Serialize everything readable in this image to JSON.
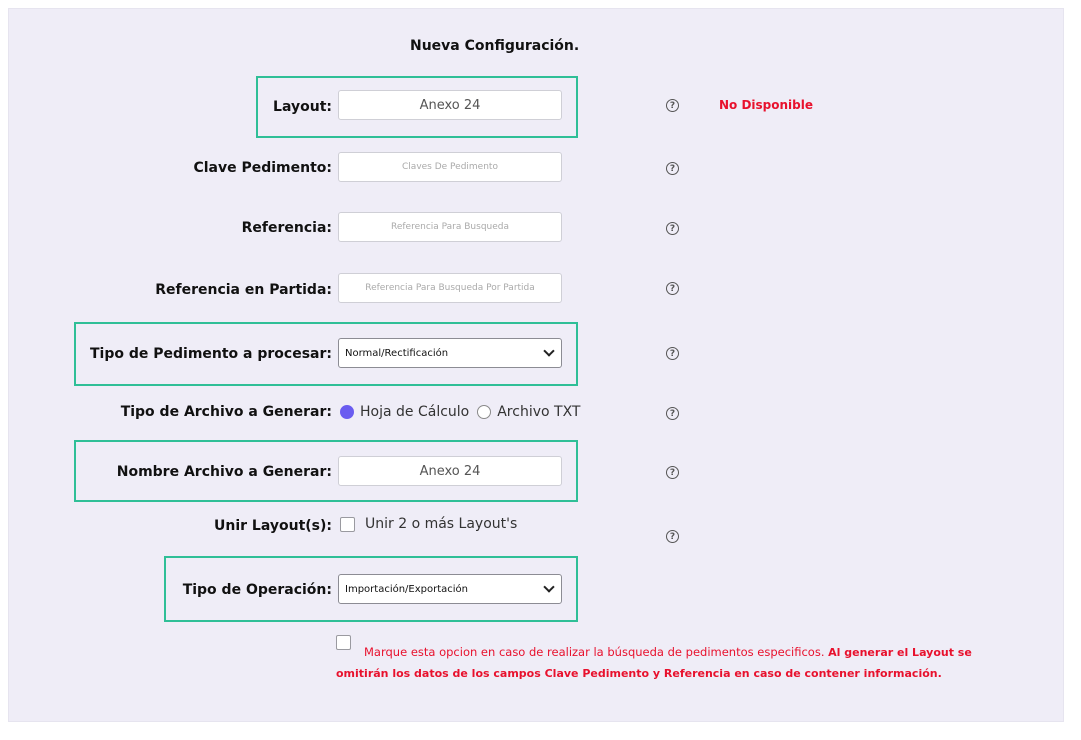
{
  "form": {
    "title": "Nueva Configuración.",
    "layout": {
      "label": "Layout:",
      "value": "Anexo 24",
      "status": "No Disponible"
    },
    "clave_pedimento": {
      "label": "Clave Pedimento:",
      "placeholder": "Claves De Pedimento"
    },
    "referencia": {
      "label": "Referencia:",
      "placeholder": "Referencia Para Busqueda"
    },
    "referencia_partida": {
      "label": "Referencia en Partida:",
      "placeholder": "Referencia Para Busqueda Por Partida"
    },
    "tipo_pedimento": {
      "label": "Tipo de Pedimento a procesar:",
      "selected": "Normal/Rectificación"
    },
    "tipo_archivo": {
      "label": "Tipo de Archivo a Generar:",
      "options": [
        {
          "label": "Hoja de Cálculo",
          "checked": true
        },
        {
          "label": "Archivo TXT",
          "checked": false
        }
      ]
    },
    "nombre_archivo": {
      "label": "Nombre Archivo a Generar:",
      "value": "Anexo 24"
    },
    "unir_layouts": {
      "label": "Unir Layout(s):",
      "checkbox_label": "Unir 2 o más Layout's",
      "checked": false
    },
    "tipo_operacion": {
      "label": "Tipo de Operación:",
      "selected": "Importación/Exportación"
    },
    "nota": {
      "normal": "Marque esta opcion en caso de realizar la búsqueda de pedimentos especificos. ",
      "bold": "Al generar el Layout se omitirán los datos de los campos Clave Pedimento y Referencia en caso de contener información.",
      "checked": false
    },
    "help_icon": "question-circle-icon"
  },
  "colors": {
    "panel_bg": "#efedf7",
    "highlight": "#2fbf97",
    "alert": "#e8112d",
    "radio_on": "#6a5cf0"
  }
}
